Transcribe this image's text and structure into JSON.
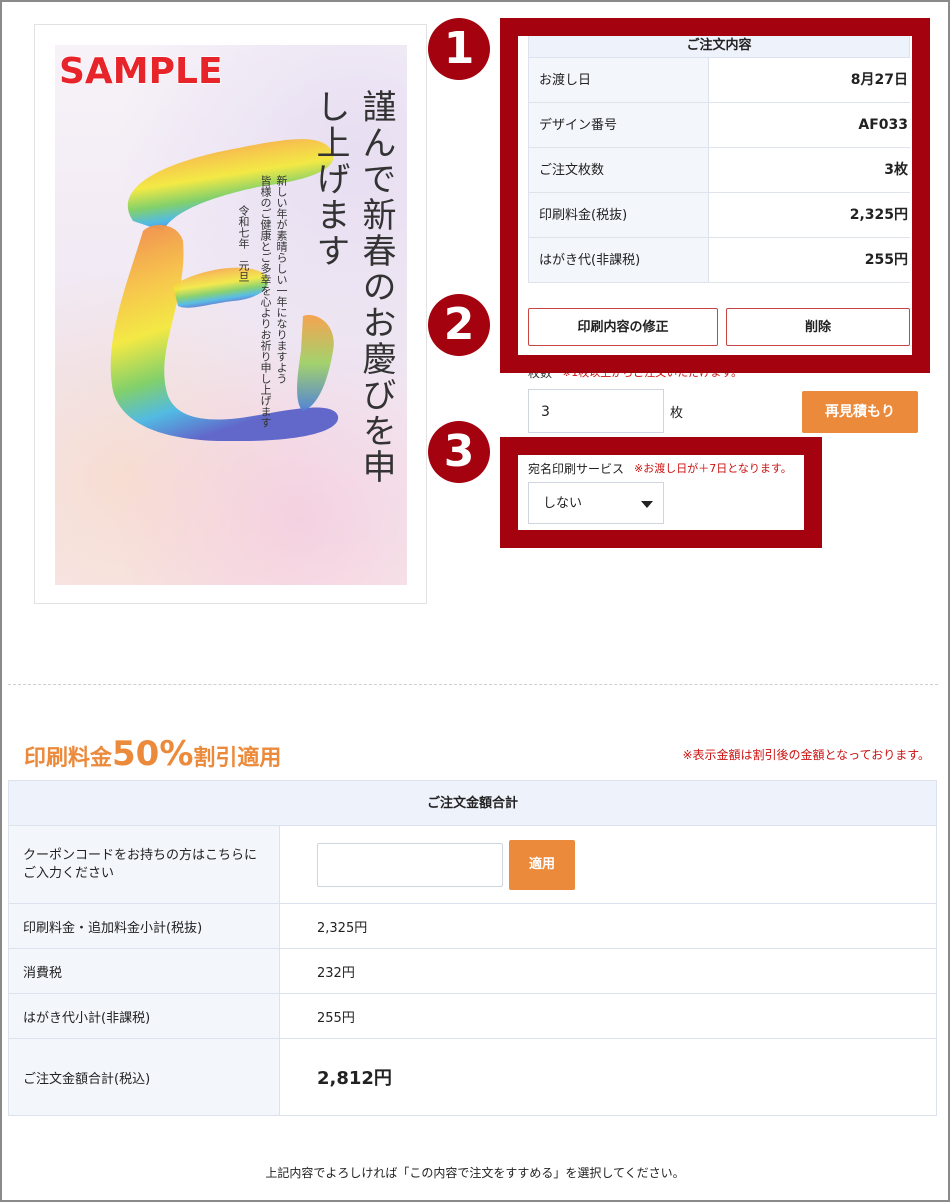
{
  "card": {
    "sample_label": "SAMPLE",
    "main_greeting": "謹んで新春のお慶びを申し上げます",
    "message_line1": "新しい年が素晴らしい一年になりますよう",
    "message_line2": "皆様のご健康とご多幸を心よりお祈り申し上げます",
    "date_line": "令和七年　元旦"
  },
  "order": {
    "header": "ご注文内容",
    "rows": [
      {
        "label": "お渡し日",
        "value": "8月27日"
      },
      {
        "label": "デザイン番号",
        "value": "AF033"
      },
      {
        "label": "ご注文枚数",
        "value": "3枚"
      },
      {
        "label": "印刷料金(税抜)",
        "value": "2,325円"
      },
      {
        "label": "はがき代(非課税)",
        "value": "255円"
      }
    ],
    "edit_button": "印刷内容の修正",
    "delete_button": "削除"
  },
  "quantity": {
    "label": "枚数",
    "note": "※1枚以上からご注文いただけます。",
    "value": "3",
    "unit": "枚",
    "requote_button": "再見積もり"
  },
  "address_service": {
    "label": "宛名印刷サービス",
    "note": "※お渡し日が＋7日となります。",
    "selected": "しない"
  },
  "badges": [
    "1",
    "2",
    "3"
  ],
  "discount": {
    "prefix": "印刷料金",
    "big": "50%",
    "suffix": "割引適用",
    "note": "※表示金額は割引後の金額となっております。"
  },
  "summary": {
    "header": "ご注文金額合計",
    "coupon_label": "クーポンコードをお持ちの方はこちらにご入力ください",
    "coupon_placeholder": "",
    "apply_button": "適用",
    "rows": [
      {
        "label": "印刷料金・追加料金小計(税抜)",
        "value": "2,325円"
      },
      {
        "label": "消費税",
        "value": "232円"
      },
      {
        "label": "はがき代小計(非課税)",
        "value": "255円"
      }
    ],
    "total_label": "ご注文金額合計(税込)",
    "total_value": "2,812円"
  },
  "footer": "上記内容でよろしければ「この内容で注文をすすめる」を選択してください。",
  "colors": {
    "accent_orange": "#ec8a3c",
    "annotation_red": "#a4020f",
    "warning_red": "#cc1111",
    "table_header_bg": "#eef2fa"
  }
}
